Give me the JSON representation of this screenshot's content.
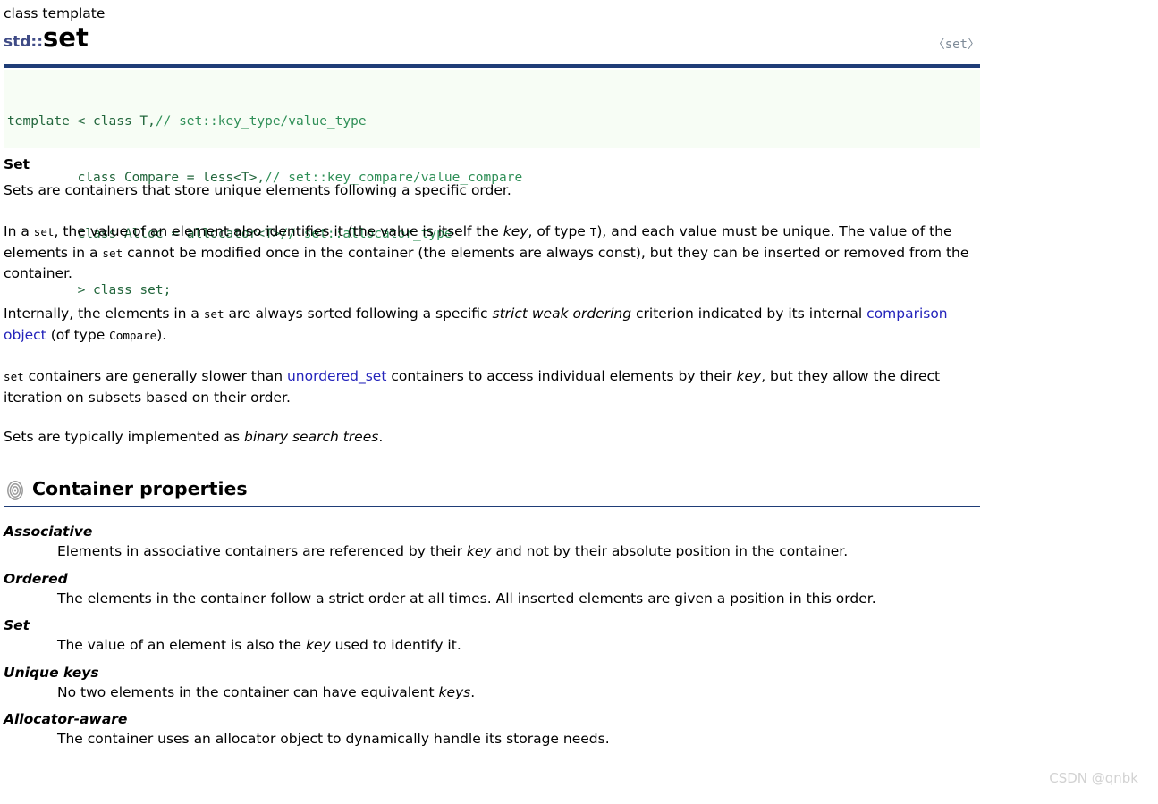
{
  "header": {
    "kind": "class template",
    "namespace": "std::",
    "name": "set",
    "include": "〈set〉"
  },
  "declaration": {
    "lines": [
      {
        "code": "template < class T,",
        "comment": "// set::key_type/value_type"
      },
      {
        "code": "         class Compare = less<T>,",
        "comment": "// set::key_compare/value_compare"
      },
      {
        "code": "         class Alloc = allocator<T>",
        "comment": "// set::allocator_type"
      },
      {
        "code": "         > class set;",
        "comment": ""
      }
    ]
  },
  "overview": {
    "title": "Set",
    "intro": "Sets are containers that store unique elements following a specific order.",
    "p2": {
      "a": "In a ",
      "code1": "set",
      "b": ", the value of an element also identifies it (the value is itself the ",
      "em1": "key",
      "c": ", of type ",
      "code2": "T",
      "d": "), and each value must be unique. The value of the elements in a ",
      "code3": "set",
      "e": " cannot be modified once in the container (the elements are always const), but they can be inserted or removed from the container."
    },
    "p3": {
      "a": "Internally, the elements in a ",
      "code1": "set",
      "b": " are always sorted following a specific ",
      "em1": "strict weak ordering",
      "c": " criterion indicated by its internal ",
      "link1": "comparison object",
      "d": " (of type ",
      "code2": "Compare",
      "e": ")."
    },
    "p4": {
      "code1": "set",
      "a": " containers are generally slower than ",
      "link1": "unordered_set",
      "b": " containers to access individual elements by their ",
      "em1": "key",
      "c": ", but they allow the direct iteration on subsets based on their order."
    },
    "p5": {
      "a": "Sets are typically implemented as ",
      "em1": "binary search trees",
      "b": "."
    }
  },
  "container_properties": {
    "heading": "Container properties",
    "icon": "spiral-icon",
    "items": [
      {
        "term": "Associative",
        "def": {
          "a": "Elements in associative containers are referenced by their ",
          "em1": "key",
          "b": " and not by their absolute position in the container."
        }
      },
      {
        "term": "Ordered",
        "def": {
          "a": "The elements in the container follow a strict order at all times. All inserted elements are given a position in this order.",
          "em1": "",
          "b": ""
        }
      },
      {
        "term": "Set",
        "def": {
          "a": "The value of an element is also the ",
          "em1": "key",
          "b": " used to identify it."
        }
      },
      {
        "term": "Unique keys",
        "def": {
          "a": "No two elements in the container can have equivalent ",
          "em1": "keys",
          "b": "."
        }
      },
      {
        "term": "Allocator-aware",
        "def": {
          "a": "The container uses an allocator object to dynamically handle its storage needs.",
          "em1": "",
          "b": ""
        }
      }
    ]
  },
  "watermark": "CSDN @qnbk",
  "colors": {
    "rule": "#1f3d77",
    "namespace": "#3f4b86",
    "link": "#2424bb",
    "code_bg": "#f7fdf5",
    "code_text": "#22663c",
    "code_comment": "#2f8f57",
    "include_text": "#7d8a97",
    "watermark": "#d2d2d2"
  }
}
